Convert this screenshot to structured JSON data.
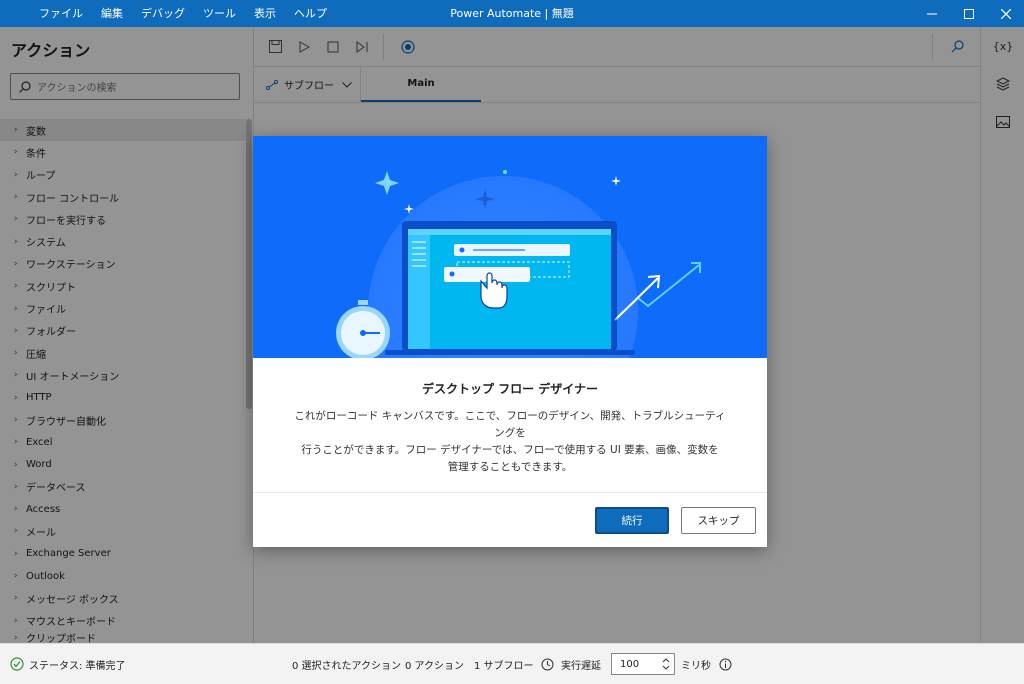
{
  "window": {
    "title": "Power Automate | 無題",
    "menu": [
      "ファイル",
      "編集",
      "デバッグ",
      "ツール",
      "表示",
      "ヘルプ"
    ]
  },
  "sidebar": {
    "title": "アクション",
    "search_placeholder": "アクションの検索",
    "items": [
      "変数",
      "条件",
      "ループ",
      "フロー コントロール",
      "フローを実行する",
      "システム",
      "ワークステーション",
      "スクリプト",
      "ファイル",
      "フォルダー",
      "圧縮",
      "UI オートメーション",
      "HTTP",
      "ブラウザー自動化",
      "Excel",
      "Word",
      "データベース",
      "Access",
      "メール",
      "Exchange Server",
      "Outlook",
      "メッセージ ボックス",
      "マウスとキーボード",
      "クリップボード"
    ]
  },
  "designer": {
    "subflow_label": "サブフロー",
    "main_tab": "Main"
  },
  "rightbar": {
    "variables_label": "{x}"
  },
  "dialog": {
    "title": "デスクトップ フロー デザイナー",
    "body_lines": [
      "これがローコード キャンバスです。ここで、フローのデザイン、開発、トラブルシューティングを",
      "行うことができます。フロー デザイナーでは、フローで使用する UI 要素、画像、変数を",
      "管理することもできます。"
    ],
    "primary_button": "続行",
    "secondary_button": "スキップ"
  },
  "status": {
    "state": "ステータス: 準備完了",
    "selected_actions": "0 選択されたアクション",
    "actions": "0 アクション",
    "subflows": "1 サブフロー",
    "delay_label": "実行遅延",
    "delay_value": "100",
    "delay_unit": "ミリ秒"
  },
  "colors": {
    "titlebar": "#0f6cbd",
    "hero": "#0f6cfa",
    "accent": "#0f6cbd"
  }
}
